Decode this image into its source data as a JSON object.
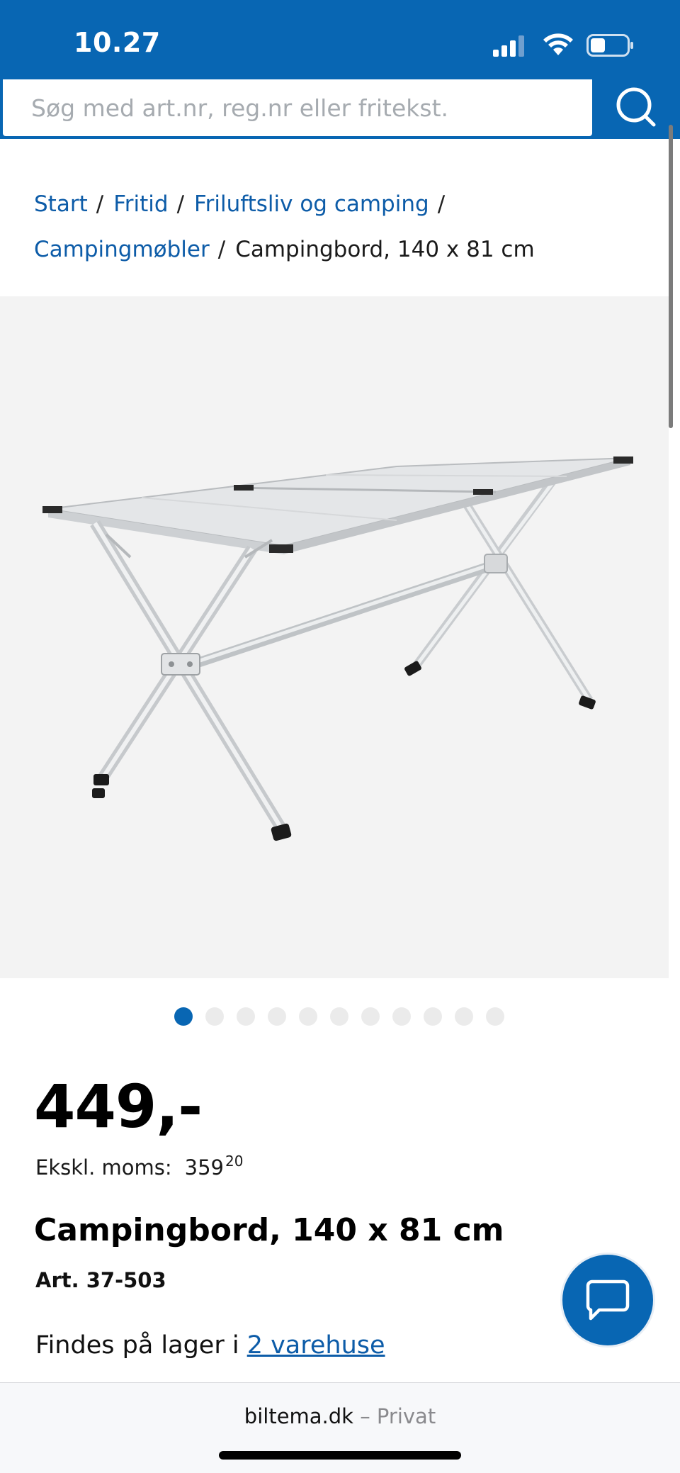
{
  "status_bar": {
    "time": "10.27"
  },
  "search": {
    "placeholder": "Søg med art.nr, reg.nr eller fritekst."
  },
  "breadcrumb": {
    "items": [
      "Start",
      "Fritid",
      "Friluftsliv og camping",
      "Campingmøbler"
    ],
    "separator": "/",
    "current": "Campingbord, 140 x 81 cm"
  },
  "carousel": {
    "total": 11,
    "active_index": 0
  },
  "product": {
    "price": "449,-",
    "ex_vat_label": "Ekskl. moms:",
    "ex_vat_whole": "359",
    "ex_vat_cents": "20",
    "title": "Campingbord, 140 x 81 cm",
    "article": "Art. 37-503",
    "stock_prefix": "Findes på lager i",
    "stock_link": "2 varehuse"
  },
  "browser": {
    "domain": "biltema.dk",
    "mode": "– Privat"
  },
  "colors": {
    "brand_blue": "#0866b3",
    "link_blue": "#0d5ca8",
    "image_bg": "#f3f3f3"
  },
  "icons": {
    "search": "search-icon",
    "chat": "chat-bubble-icon",
    "signal": "cellular-signal-icon",
    "wifi": "wifi-icon",
    "battery": "battery-icon"
  }
}
